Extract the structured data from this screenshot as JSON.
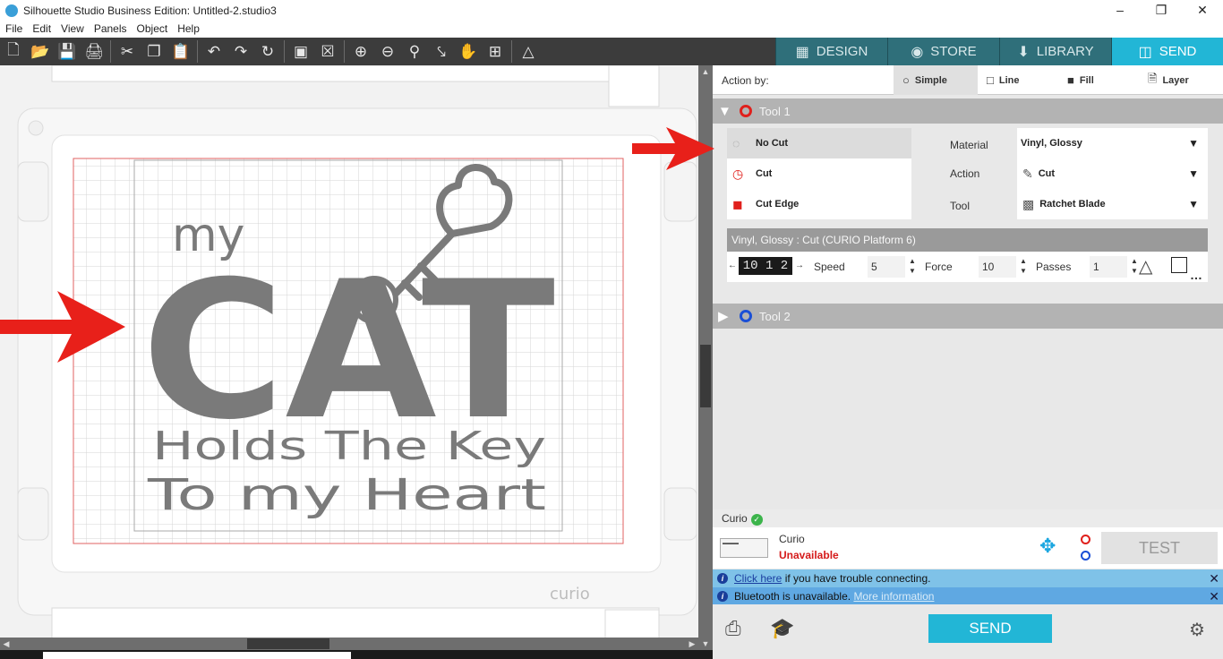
{
  "window": {
    "title": "Silhouette Studio Business Edition: Untitled-2.studio3"
  },
  "menu": [
    "File",
    "Edit",
    "View",
    "Panels",
    "Object",
    "Help"
  ],
  "tabs": [
    {
      "label": "DESIGN",
      "icon": "design-grid-icon"
    },
    {
      "label": "STORE",
      "icon": "store-s-icon"
    },
    {
      "label": "LIBRARY",
      "icon": "library-icon"
    },
    {
      "label": "SEND",
      "icon": "send-icon"
    }
  ],
  "design": {
    "line1": "my",
    "line2": "CAT",
    "line3": "Holds The Key",
    "line4": "To my Heart",
    "brand": "curio"
  },
  "action_by": {
    "label": "Action by:",
    "options": [
      "Simple",
      "Line",
      "Fill",
      "Layer"
    ],
    "selected": "Simple"
  },
  "tool1": {
    "name": "Tool 1",
    "color": "#e0201c",
    "cut_modes": [
      "No Cut",
      "Cut",
      "Cut Edge"
    ],
    "selected_mode": "No Cut",
    "material_label": "Material",
    "material": "Vinyl, Glossy",
    "action_label": "Action",
    "action": "Cut",
    "tool_label": "Tool",
    "tool": "Ratchet Blade",
    "settings_title": "Vinyl, Glossy : Cut (CURIO Platform 6)",
    "blade_display": "10 1 2",
    "speed_label": "Speed",
    "speed": "5",
    "force_label": "Force",
    "force": "10",
    "passes_label": "Passes",
    "passes": "1"
  },
  "tool2": {
    "name": "Tool 2",
    "color": "#1a4fd6"
  },
  "device": {
    "header": "Curio",
    "name": "Curio",
    "status": "Unavailable",
    "test_label": "TEST"
  },
  "notices": [
    {
      "link": "Click here",
      "text": " if you have trouble connecting."
    },
    {
      "text": "Bluetooth is unavailable. ",
      "link": "More information"
    }
  ],
  "footer": {
    "send_label": "SEND"
  }
}
